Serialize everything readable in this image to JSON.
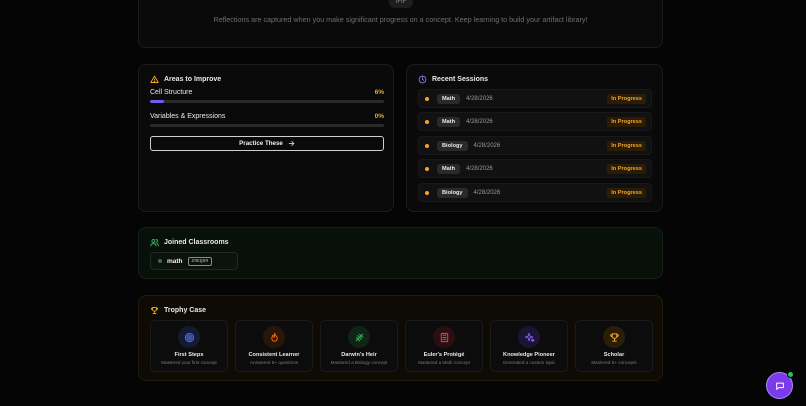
{
  "reflections": {
    "badge_label": "IFIF",
    "message": "Reflections are captured when you make significant progress on a concept. Keep learning to build your artifact library!"
  },
  "areas": {
    "title": "Areas to Improve",
    "items": [
      {
        "name": "Cell Structure",
        "percent_label": "6%",
        "progress": 0.06
      },
      {
        "name": "Variables & Expressions",
        "percent_label": "0%",
        "progress": 0.0
      }
    ],
    "practice_label": "Practice These"
  },
  "sessions": {
    "title": "Recent Sessions",
    "items": [
      {
        "subject": "Math",
        "date": "4/28/2026",
        "status": "In Progress"
      },
      {
        "subject": "Math",
        "date": "4/28/2026",
        "status": "In Progress"
      },
      {
        "subject": "Biology",
        "date": "4/28/2026",
        "status": "In Progress"
      },
      {
        "subject": "Math",
        "date": "4/28/2026",
        "status": "In Progress"
      },
      {
        "subject": "Biology",
        "date": "4/28/2026",
        "status": "In Progress"
      }
    ]
  },
  "classrooms": {
    "title": "Joined Classrooms",
    "items": [
      {
        "name": "math",
        "code": "Z9EQ5R"
      }
    ]
  },
  "trophies": {
    "title": "Trophy Case",
    "items": [
      {
        "name": "First Steps",
        "desc": "Mastered your first concept",
        "icon": "target-icon",
        "color": "#3b5bdb"
      },
      {
        "name": "Consistent Learner",
        "desc": "Answered 5+ questions",
        "icon": "flame-icon",
        "color": "#e8590c"
      },
      {
        "name": "Darwin's Heir",
        "desc": "Mastered a Biology concept",
        "icon": "dna-icon",
        "color": "#2f9e44"
      },
      {
        "name": "Euler's Protégé",
        "desc": "Mastered a Math concept",
        "icon": "calculator-icon",
        "color": "#e03131"
      },
      {
        "name": "Knowledge Pioneer",
        "desc": "Generated a custom topic",
        "icon": "sparkles-icon",
        "color": "#7048e8"
      },
      {
        "name": "Scholar",
        "desc": "Mastered 5+ concepts",
        "icon": "trophy-icon",
        "color": "#e8a317"
      }
    ]
  },
  "colors": {
    "accent": "#6f5cf6",
    "warning": "#f5a623",
    "chat": "#7c3aed"
  }
}
